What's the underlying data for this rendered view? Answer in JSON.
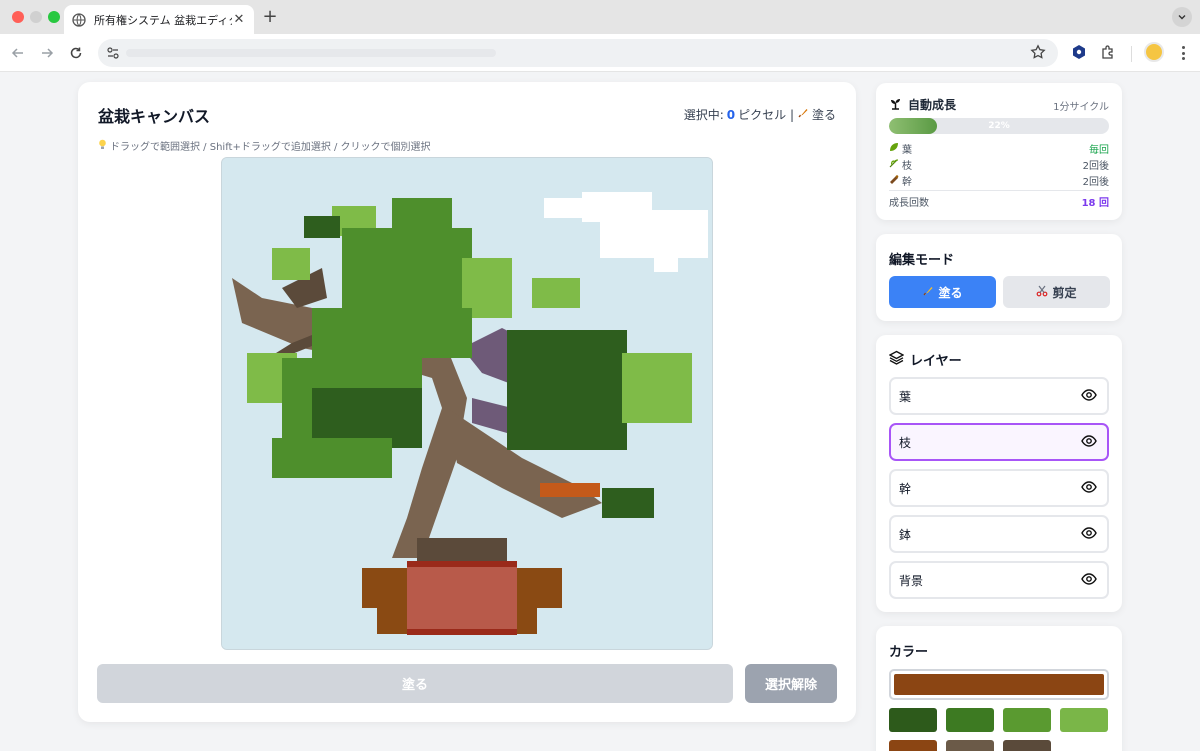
{
  "browser": {
    "tab_title": "所有権システム 盆栽エディター",
    "tab_close": "✕",
    "new_tab": "+"
  },
  "canvas": {
    "title": "盆栽キャンバス",
    "selection_prefix": "選択中:",
    "selection_count": "0",
    "selection_suffix": "ピクセル |",
    "selection_mode": "塗る",
    "hint": "ドラッグで範囲選択 / Shift+ドラッグで追加選択 / クリックで個別選択",
    "paint_button": "塗る",
    "clear_button": "選択解除",
    "colors": {
      "sky": "#d5e8ef",
      "cloud": "#ffffff",
      "trunk": "#7a6450",
      "trunk_dark": "#5b4a3a",
      "trunk_purple": "#6e5a78",
      "leaf_light": "#7fbb48",
      "leaf_mid": "#4e8f2c",
      "leaf_dark": "#2e5e1e",
      "pot_side": "#8a4a13",
      "pot_front": "#b85a4a",
      "pot_rim": "#9a2a1a",
      "branch_orange": "#c45a1a"
    }
  },
  "growth": {
    "title": "自動成長",
    "cycle": "1分サイクル",
    "progress_percent": 22,
    "progress_label": "22%",
    "rows": [
      {
        "label": "葉",
        "value": "毎回"
      },
      {
        "label": "枝",
        "value": "2回後"
      },
      {
        "label": "幹",
        "value": "2回後"
      }
    ],
    "total_label": "成長回数",
    "total_value": "18 回"
  },
  "mode": {
    "title": "編集モード",
    "paint": "塗る",
    "prune": "剪定",
    "active": "paint"
  },
  "layers": {
    "title": "レイヤー",
    "items": [
      {
        "label": "葉",
        "selected": false
      },
      {
        "label": "枝",
        "selected": true
      },
      {
        "label": "幹",
        "selected": false
      },
      {
        "label": "鉢",
        "selected": false
      },
      {
        "label": "背景",
        "selected": false
      }
    ]
  },
  "colors": {
    "title": "カラー",
    "current": "#8b4513",
    "palette": [
      "#2d5a1b",
      "#3d7a22",
      "#5a9a30",
      "#7ab648",
      "#8b4513",
      "#6b5a48",
      "#5a4a3a"
    ]
  }
}
